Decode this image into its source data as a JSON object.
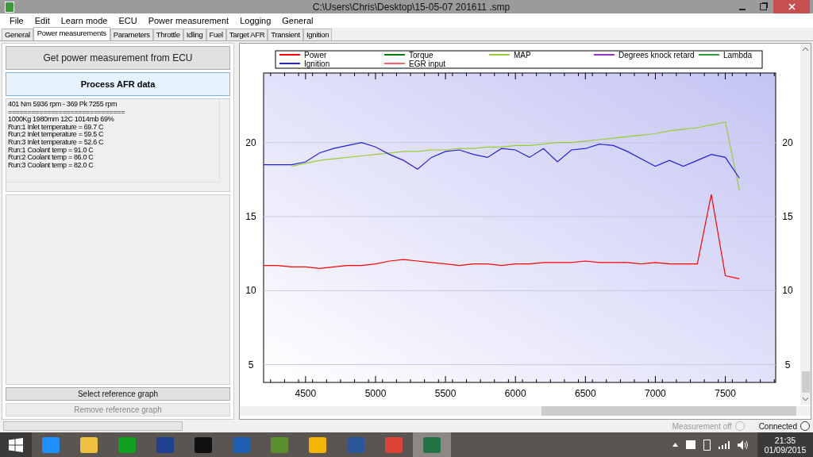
{
  "window": {
    "title": "C:\\Users\\Chris\\Desktop\\15-05-07 201611 .smp"
  },
  "menu": [
    "File",
    "Edit",
    "Learn mode",
    "ECU",
    "Power measurement",
    "Logging",
    "General"
  ],
  "tabs": [
    {
      "label": "General",
      "selected": false
    },
    {
      "label": "Power measurements",
      "selected": true
    },
    {
      "label": "Parameters",
      "selected": false
    },
    {
      "label": "Throttle",
      "selected": false
    },
    {
      "label": "Idling",
      "selected": false
    },
    {
      "label": "Fuel",
      "selected": false
    },
    {
      "label": "Target AFR",
      "selected": false
    },
    {
      "label": "Transient",
      "selected": false
    },
    {
      "label": "Ignition",
      "selected": false
    }
  ],
  "left_panel": {
    "get_button": "Get power measurement from ECU",
    "process_button": "Process AFR data",
    "results": [
      "401 Nm 5936 rpm - 369 Pk 7255 rpm",
      "==============================",
      "1000Kg 1980mm 12C 1014mb 69%",
      "Run:1 Inlet temperature = 69.7 C",
      "Run:2 Inlet temperature = 59.5 C",
      "Run:3 Inlet temperature = 52.6 C",
      "Run:1 Coolant temp = 91.0 C",
      "Run:2 Coolant temp = 86.0 C",
      "Run:3 Coolant temp = 82.0 C"
    ],
    "reference_buttons": [
      {
        "label": "Select reference graph",
        "disabled": false
      },
      {
        "label": "Remove reference graph",
        "disabled": true
      }
    ]
  },
  "chart_panel": {
    "chart_data": {
      "type": "line",
      "grid": true,
      "legend": true,
      "xlim": [
        4200,
        7860
      ],
      "ylim": [
        3.8,
        24.7
      ],
      "xticks": [
        4500,
        5000,
        5500,
        6000,
        6500,
        7000,
        7500
      ],
      "yticks": [
        5,
        10,
        15,
        20
      ],
      "y2lim": [
        3.8,
        24.7
      ],
      "y2ticks": [
        5,
        10,
        15,
        20
      ],
      "x": [
        4200,
        4300,
        4400,
        4500,
        4600,
        4700,
        4800,
        4900,
        5000,
        5100,
        5200,
        5300,
        5400,
        5500,
        5600,
        5700,
        5800,
        5900,
        6000,
        6100,
        6200,
        6300,
        6400,
        6500,
        6600,
        6700,
        6800,
        6900,
        7000,
        7100,
        7200,
        7300,
        7400,
        7500,
        7600
      ],
      "series": [
        {
          "name": "Power",
          "color": "#ff0000",
          "values": [
            11.7,
            11.7,
            11.6,
            11.6,
            11.5,
            11.6,
            11.7,
            11.7,
            11.8,
            12.0,
            12.1,
            12.0,
            11.9,
            11.8,
            11.7,
            11.8,
            11.8,
            11.7,
            11.8,
            11.8,
            11.9,
            11.9,
            11.9,
            12.0,
            11.9,
            11.9,
            11.9,
            11.8,
            11.9,
            11.8,
            11.8,
            11.8,
            16.5,
            11.0,
            10.8
          ]
        },
        {
          "name": "Torque",
          "color": "#008000",
          "values": [
            null,
            null,
            null,
            null,
            null,
            null,
            null,
            null,
            null,
            null,
            null,
            null,
            null,
            null,
            null,
            null,
            null,
            null,
            null,
            null,
            null,
            null,
            null,
            null,
            null,
            null,
            null,
            null,
            null,
            null,
            null,
            null,
            null,
            null,
            null
          ]
        },
        {
          "name": "MAP",
          "color": "#9acd32",
          "values": [
            null,
            null,
            18.4,
            18.6,
            18.8,
            18.9,
            19.0,
            19.1,
            19.2,
            19.3,
            19.4,
            19.4,
            19.5,
            19.5,
            19.6,
            19.6,
            19.7,
            19.7,
            19.8,
            19.8,
            19.9,
            20.0,
            20.0,
            20.1,
            20.2,
            20.3,
            20.4,
            20.5,
            20.6,
            20.8,
            20.9,
            21.0,
            21.2,
            21.4,
            16.8
          ]
        },
        {
          "name": "Degrees knock retard",
          "color": "#9932cc",
          "values": [
            null,
            null,
            null,
            null,
            null,
            null,
            null,
            null,
            null,
            null,
            null,
            null,
            null,
            null,
            null,
            null,
            null,
            null,
            null,
            null,
            null,
            null,
            null,
            null,
            null,
            null,
            null,
            null,
            null,
            null,
            null,
            null,
            null,
            null,
            null
          ]
        },
        {
          "name": "Lambda",
          "color": "#32a032",
          "values": [
            null,
            null,
            null,
            null,
            null,
            null,
            null,
            null,
            null,
            null,
            null,
            null,
            null,
            null,
            null,
            null,
            null,
            null,
            null,
            null,
            null,
            null,
            null,
            null,
            null,
            null,
            null,
            null,
            null,
            null,
            null,
            null,
            null,
            null,
            null
          ]
        },
        {
          "name": "Ignition",
          "color": "#2020e0",
          "values": [
            18.5,
            18.5,
            18.5,
            18.7,
            19.3,
            19.6,
            19.8,
            20.0,
            19.7,
            19.2,
            18.8,
            18.2,
            19.0,
            19.4,
            19.5,
            19.2,
            19.0,
            19.6,
            19.5,
            19.0,
            19.6,
            18.7,
            19.5,
            19.6,
            19.9,
            19.8,
            19.4,
            18.9,
            18.4,
            18.8,
            18.4,
            18.8,
            19.2,
            19.0,
            17.6
          ]
        },
        {
          "name": "EGR input",
          "color": "#ff6060",
          "values": [
            null,
            null,
            null,
            null,
            null,
            null,
            null,
            null,
            null,
            null,
            null,
            null,
            null,
            null,
            null,
            null,
            null,
            null,
            null,
            null,
            null,
            null,
            null,
            null,
            null,
            null,
            null,
            null,
            null,
            null,
            null,
            null,
            null,
            null,
            null
          ]
        }
      ]
    }
  },
  "status_bar": {
    "progress": {
      "level": 0
    },
    "indicators": [
      {
        "label": "Measurement off",
        "disabled": true,
        "on": false
      },
      {
        "label": "Connected",
        "disabled": false,
        "on": false
      }
    ]
  },
  "taskbar": {
    "time": "21:35",
    "date": "01/09/2015"
  }
}
